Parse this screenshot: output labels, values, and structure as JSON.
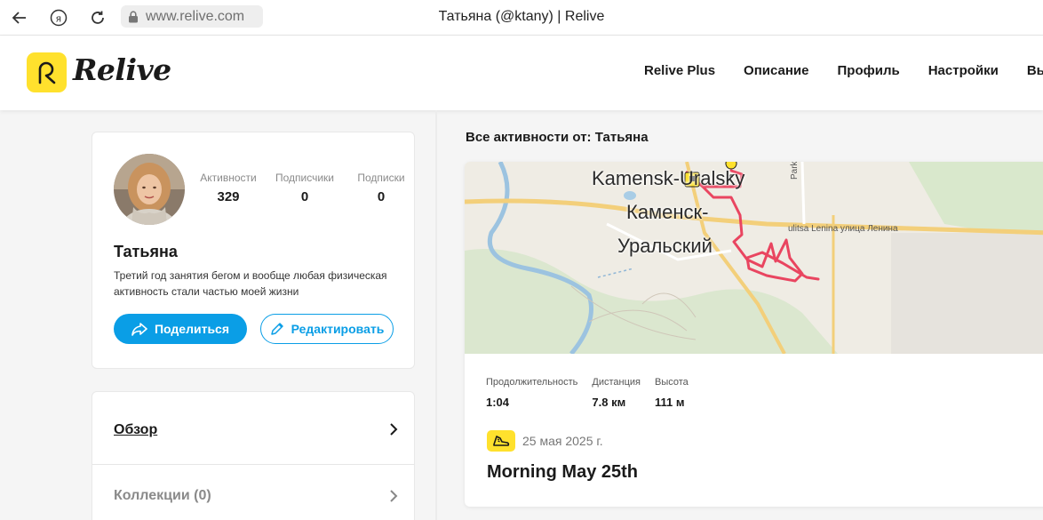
{
  "browser": {
    "url": "www.relive.com",
    "tab_title": "Татьяна (@ktany) | Relive"
  },
  "header": {
    "logo_text": "Relive",
    "nav": [
      "Relive Plus",
      "Описание",
      "Профиль",
      "Настройки",
      "Вый"
    ]
  },
  "profile": {
    "name": "Татьяна",
    "bio": "Третий год занятия бегом и вообще любая физическая активность стали частью моей жизни",
    "stats": [
      {
        "label": "Активности",
        "value": "329"
      },
      {
        "label": "Подписчики",
        "value": "0"
      },
      {
        "label": "Подписки",
        "value": "0"
      }
    ],
    "share_label": "Поделиться",
    "edit_label": "Редактировать"
  },
  "menu": {
    "overview": "Обзор",
    "collections": "Коллекции (0)"
  },
  "activities": {
    "section_title": "Все активности от: Татьяна",
    "card": {
      "map_labels": {
        "city_latin": "Kamensk-Uralsky",
        "city_ru_1": "Каменск-",
        "city_ru_2": "Уральский",
        "street": "ulitsa Lenina улица Ленина",
        "street2": "Parkov"
      },
      "metrics": [
        {
          "label": "Продолжительность",
          "value": "1:04"
        },
        {
          "label": "Дистанция",
          "value": "7.8 км"
        },
        {
          "label": "Высота",
          "value": "111 м"
        }
      ],
      "date": "25 мая 2025 г.",
      "title": "Morning May 25th",
      "activity_icon": "running-shoe-icon"
    }
  },
  "colors": {
    "brand_yellow": "#ffe12d",
    "accent_blue": "#0a9ee6",
    "route_red": "#e94560"
  }
}
